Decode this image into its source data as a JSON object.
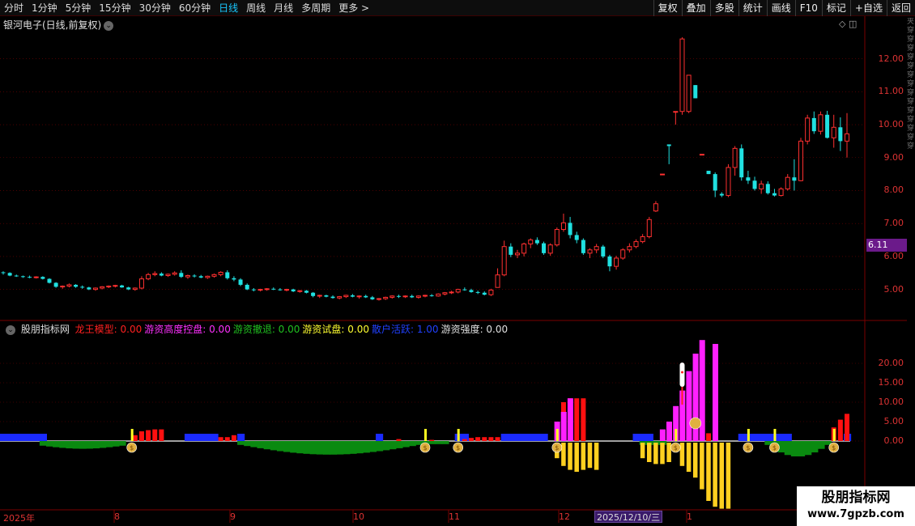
{
  "toolbar": {
    "periods": [
      "分时",
      "1分钟",
      "5分钟",
      "15分钟",
      "30分钟",
      "60分钟",
      "日线",
      "周线",
      "月线",
      "多周期",
      "更多 >"
    ],
    "active_index": 6,
    "buttons": [
      "复权",
      "叠加",
      "多股",
      "统计",
      "画线",
      "F10",
      "标记",
      "+自选",
      "返回"
    ]
  },
  "main": {
    "title": "银河电子(日线,前复权)",
    "price_axis": [
      "12.00",
      "11.00",
      "10.00",
      "9.00",
      "8.00",
      "7.00",
      "6.00",
      "5.00"
    ],
    "current_price": "6.11"
  },
  "indicator": {
    "name": "股朋指标网",
    "fields": [
      {
        "label": "龙王模型: 0.00",
        "color": "#ff2020"
      },
      {
        "label": "游资高度控盘: 0.00",
        "color": "#ff30ff"
      },
      {
        "label": "游资撤退: 0.00",
        "color": "#20c020"
      },
      {
        "label": "游资试盘: 0.00",
        "color": "#ffff30"
      },
      {
        "label": "散户活跃: 1.00",
        "color": "#2040ff"
      },
      {
        "label": "游资强度: 0.00",
        "color": "#e0e0e0"
      }
    ],
    "axis": [
      "20.00",
      "15.00",
      "10.00",
      "5.00",
      "0.00"
    ]
  },
  "time_axis": {
    "labels": [
      "2025年",
      "8",
      "9",
      "10",
      "11",
      "12",
      "1"
    ],
    "cursor_date": "2025/12/10/三"
  },
  "watermark": {
    "line1": "股朋指标网",
    "line2": "www.7gpzb.com"
  },
  "colors": {
    "up": "#ff3030",
    "down": "#20e0e0",
    "bg": "#000000",
    "grid": "#7a0000"
  },
  "chart_data": {
    "type": "candlestick",
    "price_range": [
      4.5,
      12.8
    ],
    "candles": [
      [
        5.52,
        5.55,
        5.45,
        5.5
      ],
      [
        5.5,
        5.52,
        5.4,
        5.42
      ],
      [
        5.42,
        5.45,
        5.38,
        5.4
      ],
      [
        5.4,
        5.42,
        5.35,
        5.38
      ],
      [
        5.38,
        5.42,
        5.34,
        5.36
      ],
      [
        5.36,
        5.4,
        5.33,
        5.38
      ],
      [
        5.38,
        5.4,
        5.3,
        5.32
      ],
      [
        5.32,
        5.34,
        5.18,
        5.2
      ],
      [
        5.2,
        5.22,
        5.05,
        5.08
      ],
      [
        5.08,
        5.12,
        5.02,
        5.1
      ],
      [
        5.1,
        5.18,
        5.06,
        5.14
      ],
      [
        5.14,
        5.16,
        5.05,
        5.08
      ],
      [
        5.08,
        5.12,
        5.02,
        5.06
      ],
      [
        5.06,
        5.08,
        4.98,
        5.0
      ],
      [
        5.0,
        5.06,
        4.96,
        5.04
      ],
      [
        5.04,
        5.1,
        5.0,
        5.08
      ],
      [
        5.08,
        5.12,
        5.04,
        5.1
      ],
      [
        5.1,
        5.14,
        5.06,
        5.12
      ],
      [
        5.12,
        5.14,
        5.05,
        5.06
      ],
      [
        5.06,
        5.08,
        4.98,
        5.0
      ],
      [
        5.0,
        5.06,
        4.96,
        5.04
      ],
      [
        5.04,
        5.4,
        5.0,
        5.32
      ],
      [
        5.32,
        5.5,
        5.28,
        5.45
      ],
      [
        5.45,
        5.55,
        5.4,
        5.48
      ],
      [
        5.48,
        5.52,
        5.4,
        5.42
      ],
      [
        5.42,
        5.48,
        5.38,
        5.46
      ],
      [
        5.46,
        5.55,
        5.42,
        5.5
      ],
      [
        5.5,
        5.58,
        5.35,
        5.38
      ],
      [
        5.38,
        5.45,
        5.32,
        5.42
      ],
      [
        5.42,
        5.46,
        5.36,
        5.4
      ],
      [
        5.4,
        5.44,
        5.34,
        5.36
      ],
      [
        5.36,
        5.42,
        5.32,
        5.4
      ],
      [
        5.4,
        5.48,
        5.36,
        5.45
      ],
      [
        5.45,
        5.55,
        5.4,
        5.52
      ],
      [
        5.52,
        5.58,
        5.3,
        5.34
      ],
      [
        5.34,
        5.4,
        5.25,
        5.3
      ],
      [
        5.3,
        5.34,
        5.1,
        5.14
      ],
      [
        5.14,
        5.18,
        4.98,
        5.0
      ],
      [
        5.0,
        5.04,
        4.94,
        4.98
      ],
      [
        4.98,
        5.02,
        4.94,
        5.0
      ],
      [
        5.0,
        5.04,
        4.96,
        5.02
      ],
      [
        5.02,
        5.06,
        4.98,
        5.0
      ],
      [
        5.0,
        5.04,
        4.96,
        4.98
      ],
      [
        4.98,
        5.02,
        4.94,
        5.0
      ],
      [
        5.0,
        5.02,
        4.92,
        4.94
      ],
      [
        4.94,
        4.98,
        4.9,
        4.96
      ],
      [
        4.96,
        4.98,
        4.88,
        4.9
      ],
      [
        4.9,
        4.92,
        4.76,
        4.8
      ],
      [
        4.8,
        4.84,
        4.74,
        4.82
      ],
      [
        4.82,
        4.84,
        4.76,
        4.78
      ],
      [
        4.78,
        4.82,
        4.72,
        4.74
      ],
      [
        4.74,
        4.8,
        4.7,
        4.78
      ],
      [
        4.78,
        4.84,
        4.74,
        4.82
      ],
      [
        4.82,
        4.86,
        4.76,
        4.78
      ],
      [
        4.78,
        4.82,
        4.72,
        4.8
      ],
      [
        4.8,
        4.84,
        4.74,
        4.76
      ],
      [
        4.76,
        4.8,
        4.68,
        4.7
      ],
      [
        4.7,
        4.74,
        4.66,
        4.72
      ],
      [
        4.72,
        4.78,
        4.68,
        4.76
      ],
      [
        4.76,
        4.82,
        4.72,
        4.8
      ],
      [
        4.8,
        4.84,
        4.74,
        4.78
      ],
      [
        4.78,
        4.82,
        4.74,
        4.8
      ],
      [
        4.8,
        4.84,
        4.74,
        4.76
      ],
      [
        4.76,
        4.82,
        4.72,
        4.8
      ],
      [
        4.8,
        4.84,
        4.76,
        4.82
      ],
      [
        4.82,
        4.86,
        4.78,
        4.8
      ],
      [
        4.8,
        4.88,
        4.78,
        4.86
      ],
      [
        4.86,
        4.92,
        4.82,
        4.9
      ],
      [
        4.9,
        4.96,
        4.86,
        4.92
      ],
      [
        4.92,
        5.02,
        4.88,
        5.0
      ],
      [
        5.0,
        5.06,
        4.96,
        4.98
      ],
      [
        4.98,
        5.02,
        4.9,
        4.92
      ],
      [
        4.92,
        4.96,
        4.86,
        4.9
      ],
      [
        4.9,
        4.94,
        4.82,
        4.84
      ],
      [
        4.84,
        5.02,
        4.8,
        4.98
      ],
      [
        5.06,
        5.64,
        5.4,
        5.44
      ],
      [
        5.44,
        6.48,
        5.4,
        6.3
      ],
      [
        6.3,
        6.4,
        5.98,
        6.05
      ],
      [
        6.05,
        6.2,
        5.95,
        6.1
      ],
      [
        6.1,
        6.42,
        6.0,
        6.38
      ],
      [
        6.38,
        6.55,
        6.25,
        6.5
      ],
      [
        6.5,
        6.58,
        6.35,
        6.4
      ],
      [
        6.4,
        6.45,
        6.05,
        6.1
      ],
      [
        6.1,
        6.4,
        6.02,
        6.35
      ],
      [
        6.35,
        6.88,
        6.3,
        6.82
      ],
      [
        6.82,
        7.3,
        6.75,
        7.02
      ],
      [
        7.02,
        7.2,
        6.55,
        6.65
      ],
      [
        6.65,
        6.75,
        6.4,
        6.5
      ],
      [
        6.5,
        6.55,
        6.05,
        6.1
      ],
      [
        6.1,
        6.25,
        5.95,
        6.2
      ],
      [
        6.2,
        6.38,
        6.1,
        6.3
      ],
      [
        6.3,
        6.35,
        5.95,
        6.0
      ],
      [
        6.0,
        6.05,
        5.55,
        5.7
      ],
      [
        5.7,
        6.02,
        5.6,
        5.95
      ],
      [
        5.95,
        6.25,
        5.9,
        6.2
      ],
      [
        6.2,
        6.4,
        6.12,
        6.3
      ],
      [
        6.3,
        6.52,
        6.25,
        6.45
      ],
      [
        6.45,
        6.68,
        6.4,
        6.6
      ],
      [
        6.6,
        7.2,
        6.55,
        7.12
      ],
      [
        7.38,
        7.68,
        7.35,
        7.6
      ],
      [
        8.5,
        8.5,
        8.5,
        8.5
      ],
      [
        9.4,
        9.4,
        8.8,
        9.35
      ],
      [
        10.4,
        10.4,
        10.0,
        10.4
      ],
      [
        10.4,
        12.65,
        10.3,
        12.6
      ],
      [
        10.4,
        11.5,
        10.35,
        11.5
      ],
      [
        11.2,
        11.2,
        10.8,
        10.8
      ],
      [
        9.1,
        9.1,
        9.1,
        9.1
      ],
      [
        8.6,
        8.6,
        8.5,
        8.5
      ],
      [
        8.5,
        8.55,
        7.8,
        8.0
      ],
      [
        7.9,
        7.95,
        7.8,
        7.85
      ],
      [
        7.85,
        8.8,
        7.8,
        8.7
      ],
      [
        8.7,
        9.35,
        8.45,
        9.28
      ],
      [
        9.28,
        9.4,
        8.3,
        8.4
      ],
      [
        8.4,
        8.6,
        8.2,
        8.3
      ],
      [
        8.3,
        8.42,
        8.0,
        8.05
      ],
      [
        8.05,
        8.3,
        7.9,
        8.2
      ],
      [
        8.2,
        8.28,
        7.88,
        7.92
      ],
      [
        7.92,
        8.05,
        7.82,
        7.85
      ],
      [
        7.85,
        8.1,
        7.82,
        8.05
      ],
      [
        8.05,
        8.5,
        8.0,
        8.4
      ],
      [
        8.4,
        8.95,
        8.0,
        8.3
      ],
      [
        8.3,
        9.6,
        8.28,
        9.5
      ],
      [
        9.5,
        10.3,
        9.4,
        10.2
      ],
      [
        10.2,
        10.4,
        9.72,
        9.8
      ],
      [
        9.8,
        10.4,
        9.7,
        10.3
      ],
      [
        10.3,
        10.42,
        9.58,
        9.6
      ],
      [
        9.6,
        10.3,
        9.3,
        9.92
      ],
      [
        9.92,
        10.22,
        9.2,
        9.5
      ],
      [
        9.5,
        10.35,
        9.0,
        9.72
      ]
    ],
    "indicator": {
      "series": [
        "龙王模型",
        "游资高度控盘",
        "游资撤退",
        "游资试盘",
        "散户活跃",
        "游资强度"
      ],
      "y_range": [
        -17,
        27
      ]
    }
  }
}
